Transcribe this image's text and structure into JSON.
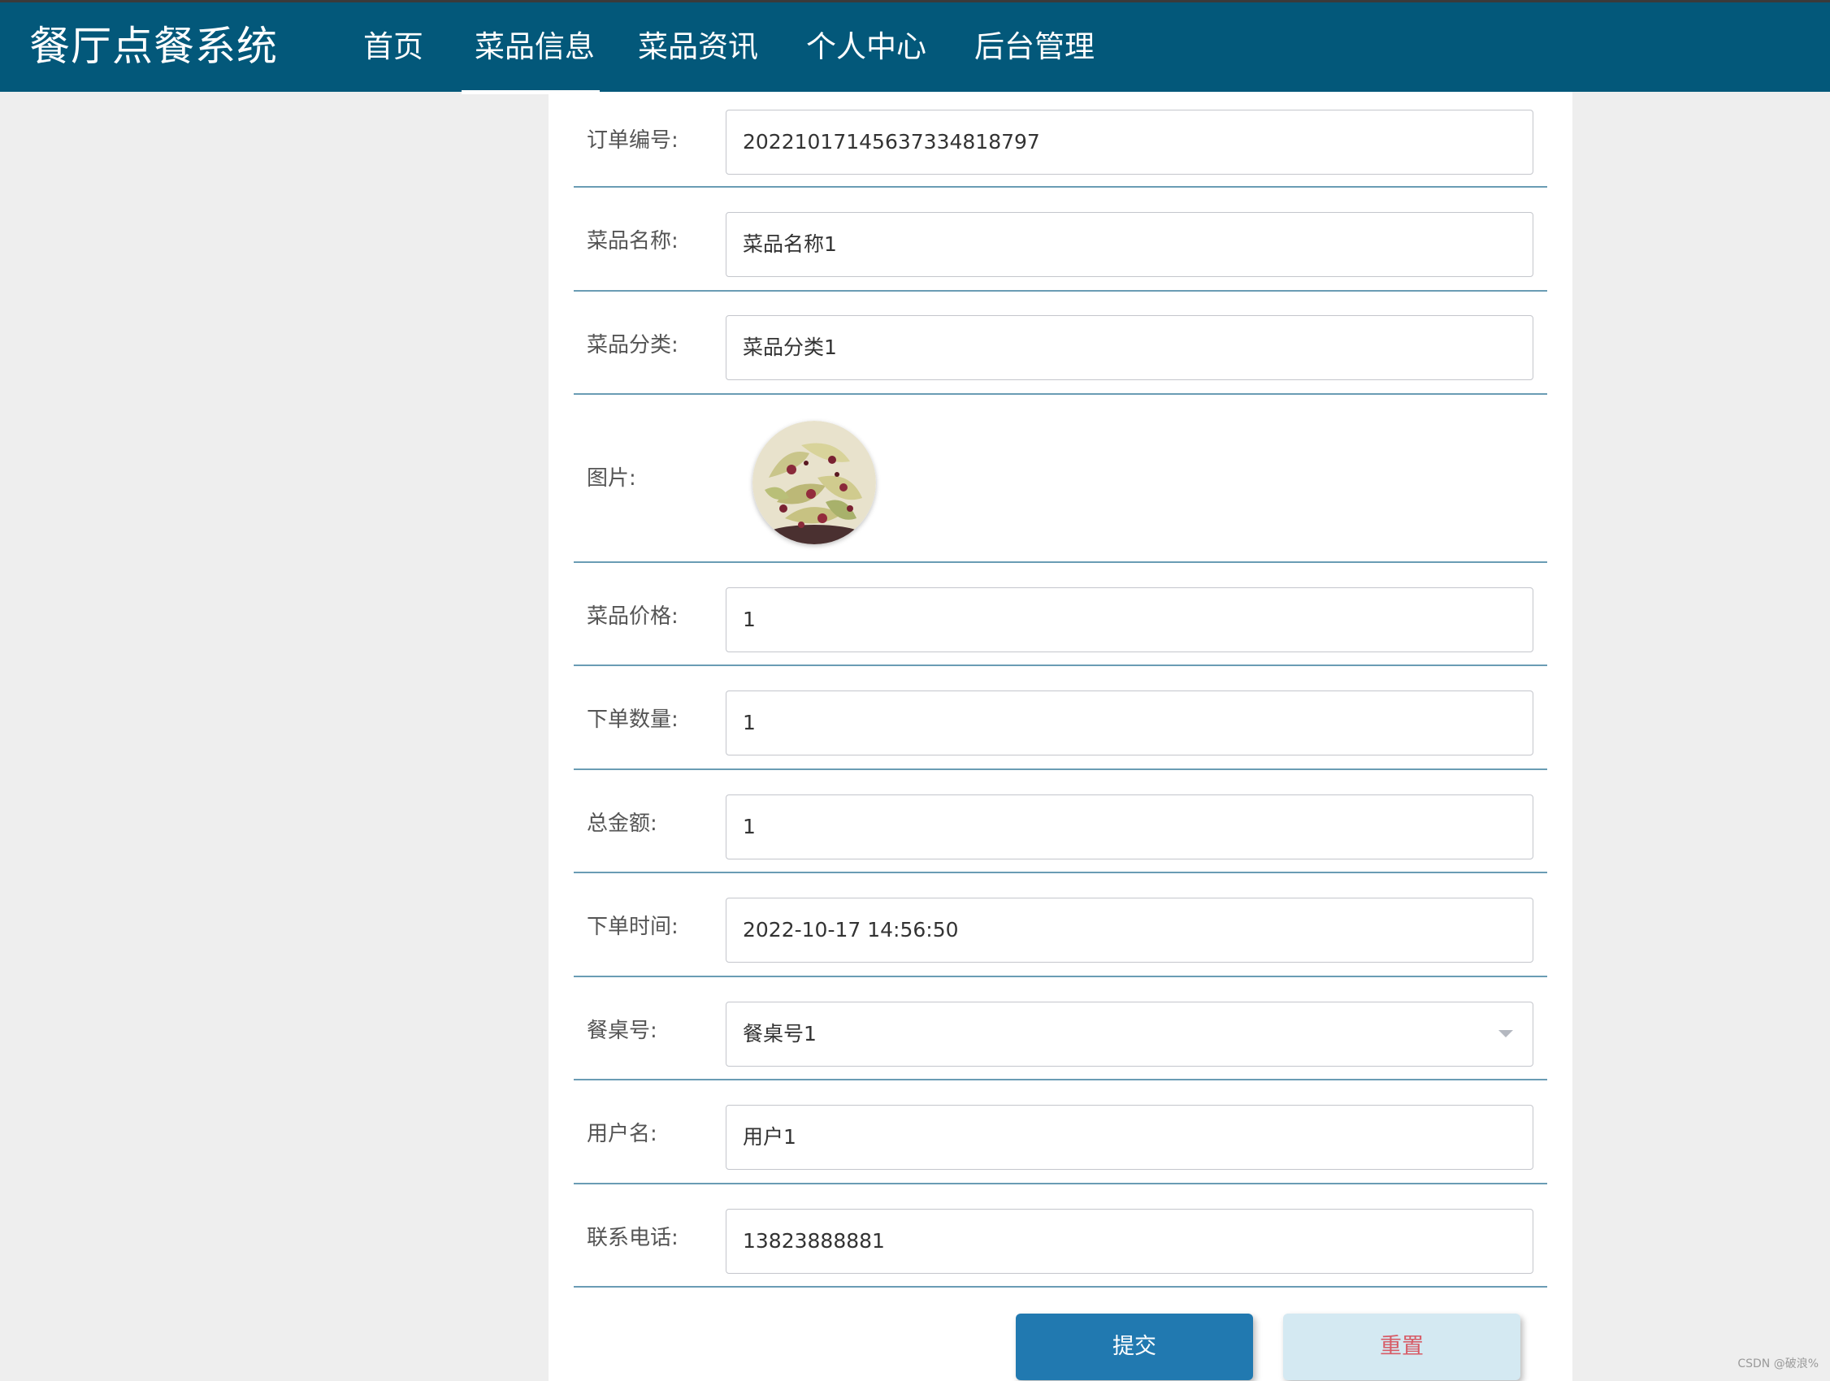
{
  "header": {
    "brand": "餐厅点餐系统",
    "nav": [
      "首页",
      "菜品信息",
      "菜品资讯",
      "个人中心",
      "后台管理"
    ],
    "active_index": 1
  },
  "form": {
    "order_no": {
      "label": "订单编号:",
      "value": "20221017145637334818797"
    },
    "dish_name": {
      "label": "菜品名称:",
      "value": "菜品名称1"
    },
    "dish_category": {
      "label": "菜品分类:",
      "value": "菜品分类1"
    },
    "image": {
      "label": "图片:"
    },
    "price": {
      "label": "菜品价格:",
      "value": "1"
    },
    "quantity": {
      "label": "下单数量:",
      "value": "1"
    },
    "total": {
      "label": "总金额:",
      "value": "1"
    },
    "order_time": {
      "label": "下单时间:",
      "value": "2022-10-17 14:56:50"
    },
    "table_no": {
      "label": "餐桌号:",
      "value": "餐桌号1"
    },
    "username": {
      "label": "用户名:",
      "value": "用户1"
    },
    "phone": {
      "label": "联系电话:",
      "value": "13823888881"
    }
  },
  "buttons": {
    "submit": "提交",
    "reset": "重置"
  },
  "watermark": "CSDN @破浪%",
  "colors": {
    "navbar": "#03587a",
    "submit_bg": "#2179b0",
    "reset_bg": "#d4e9f2",
    "reset_text": "#d75b66",
    "row_divider": "#6a9cb4"
  }
}
